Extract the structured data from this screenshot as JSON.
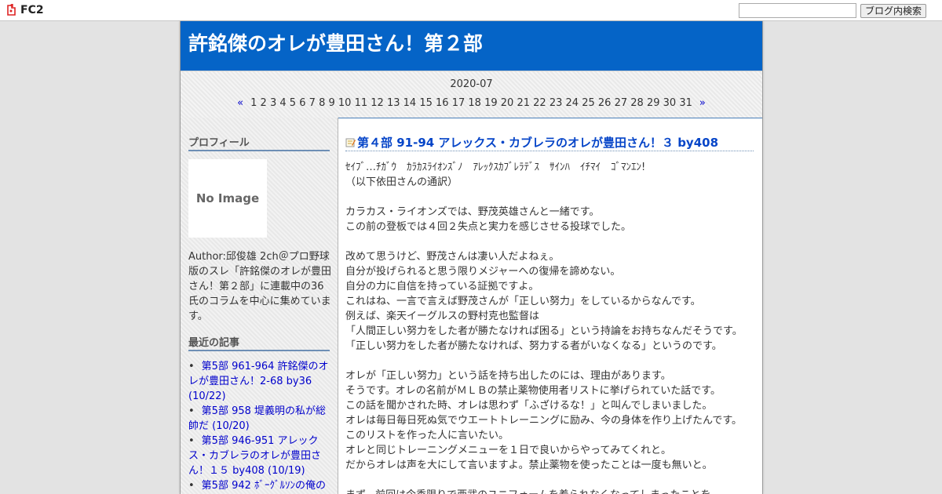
{
  "fc2bar": {
    "logo_text": "FC2",
    "search_placeholder": "",
    "search_button": "ブログ内検索"
  },
  "header": {
    "title": "許銘傑のオレが豊田さん！第２部",
    "bg_color": "#0564c7"
  },
  "calendar": {
    "month": "2020-07",
    "prev": "«",
    "next": "»",
    "days": [
      "1",
      "2",
      "3",
      "4",
      "5",
      "6",
      "7",
      "8",
      "9",
      "10",
      "11",
      "12",
      "13",
      "14",
      "15",
      "16",
      "17",
      "18",
      "19",
      "20",
      "21",
      "22",
      "23",
      "24",
      "25",
      "26",
      "27",
      "28",
      "29",
      "30",
      "31"
    ]
  },
  "sidebar": {
    "profile_heading": "プロフィール",
    "no_image": "No Image",
    "profile_text": "Author:邱俊雄 2ch＠プロ野球版のスレ「許銘傑のオレが豊田さん！第２部」に連載中の36氏のコラムを中心に集めています。",
    "recent_heading": "最近の記事",
    "recent_items": [
      "第5部 961-964 許銘傑のオレが豊田さん！2-68 by36 (10/22)",
      "第5部 958 堤義明の私が総帥だ (10/20)",
      "第5部 946-951 アレックス・カブレラのオレが豊田さん！１５ by408 (10/19)",
      "第5部 942 ﾎﾞｰｸﾞﾙｿﾝの俺の"
    ]
  },
  "entry": {
    "title": "第４部 91-94 アレックス・カブレラのオレが豊田さん！３ by408",
    "lines": [
      "ｾｲﾌﾞ…ﾁｶﾞｳ　ｶﾗｶｽﾗｲｵﾝｽﾞﾉ　ｱﾚｯｸｽｶﾌﾞﾚﾗﾃﾞｽ　ｻｲﾝﾊ　ｲﾁﾏｲ　ｺﾞﾏﾝｴﾝ!",
      "（以下依田さんの通訳）",
      "",
      "カラカス・ライオンズでは、野茂英雄さんと一緒です。",
      "この前の登板では４回２失点と実力を感じさせる投球でした。",
      "",
      "改めて思うけど、野茂さんは凄い人だよねぇ。",
      "自分が投げられると思う限りメジャーへの復帰を諦めない。",
      "自分の力に自信を持っている証拠ですよ。",
      "これはね、一言で言えば野茂さんが「正しい努力」をしているからなんです。",
      "例えば、楽天イーグルスの野村克也監督は",
      "「人間正しい努力をした者が勝たなければ困る」という持論をお持ちなんだそうです。",
      "「正しい努力をした者が勝たなければ、努力する者がいなくなる」というのです。",
      "",
      "オレが「正しい努力」という話を持ち出したのには、理由があります。",
      "そうです。オレの名前がＭＬＢの禁止薬物使用者リストに挙げられていた話です。",
      "この話を聞かされた時、オレは思わず「ふざけるな！」と叫んでしまいました。",
      "オレは毎日毎日死ぬ気でウエートトレーニングに励み、今の身体を作り上げたんです。",
      "このリストを作った人に言いたい。",
      "オレと同じトレーニングメニューを１日で良いからやってみてくれと。",
      "だからオレは声を大にして言いますよ。禁止薬物を使ったことは一度も無いと。",
      "",
      "まず、前回は今季限りで西武のユニフォームを着られなくなってしまったことを"
    ]
  }
}
